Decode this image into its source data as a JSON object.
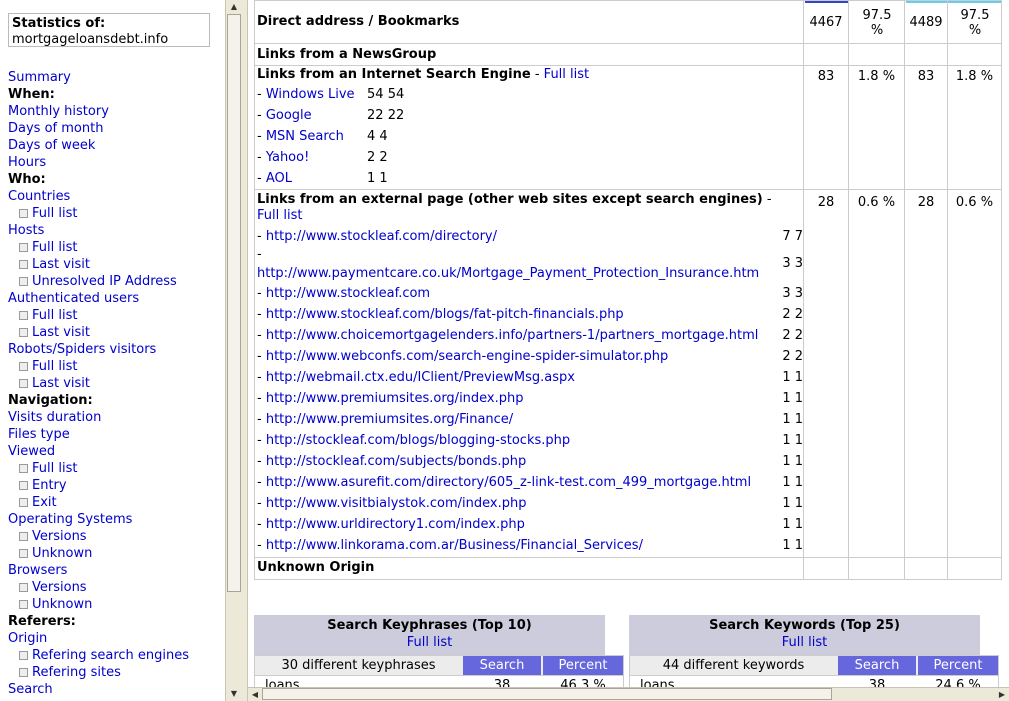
{
  "left": {
    "stats_title": "Statistics of:",
    "site": "mortgageloansdebt.info",
    "menu": [
      {
        "t": "Summary",
        "k": "link"
      },
      {
        "t": "When:",
        "k": "head"
      },
      {
        "t": "Monthly history",
        "k": "link"
      },
      {
        "t": "Days of month",
        "k": "link"
      },
      {
        "t": "Days of week",
        "k": "link"
      },
      {
        "t": "Hours",
        "k": "link"
      },
      {
        "t": "Who:",
        "k": "head"
      },
      {
        "t": "Countries",
        "k": "link"
      },
      {
        "t": "Full list",
        "k": "sub"
      },
      {
        "t": "Hosts",
        "k": "link"
      },
      {
        "t": "Full list",
        "k": "sub"
      },
      {
        "t": "Last visit",
        "k": "sub"
      },
      {
        "t": "Unresolved IP Address",
        "k": "sub"
      },
      {
        "t": "Authenticated users",
        "k": "link"
      },
      {
        "t": "Full list",
        "k": "sub"
      },
      {
        "t": "Last visit",
        "k": "sub"
      },
      {
        "t": "Robots/Spiders visitors",
        "k": "link"
      },
      {
        "t": "Full list",
        "k": "sub"
      },
      {
        "t": "Last visit",
        "k": "sub"
      },
      {
        "t": "Navigation:",
        "k": "head"
      },
      {
        "t": "Visits duration",
        "k": "link"
      },
      {
        "t": "Files type",
        "k": "link"
      },
      {
        "t": "Viewed",
        "k": "link"
      },
      {
        "t": "Full list",
        "k": "sub"
      },
      {
        "t": "Entry",
        "k": "sub"
      },
      {
        "t": "Exit",
        "k": "sub"
      },
      {
        "t": "Operating Systems",
        "k": "link"
      },
      {
        "t": "Versions",
        "k": "sub"
      },
      {
        "t": "Unknown",
        "k": "sub"
      },
      {
        "t": "Browsers",
        "k": "link"
      },
      {
        "t": "Versions",
        "k": "sub"
      },
      {
        "t": "Unknown",
        "k": "sub"
      },
      {
        "t": "Referers:",
        "k": "head"
      },
      {
        "t": "Origin",
        "k": "link"
      },
      {
        "t": "Refering search engines",
        "k": "sub"
      },
      {
        "t": "Refering sites",
        "k": "sub"
      },
      {
        "t": "Search",
        "k": "link"
      }
    ]
  },
  "origin": {
    "direct": {
      "label": "Direct address / Bookmarks",
      "pages": "4467",
      "pages_pct": "97.5 %",
      "hits": "4489",
      "hits_pct": "97.5 %"
    },
    "newsgroup": {
      "label": "Links from a NewsGroup"
    },
    "search_engine": {
      "label": "Links from an Internet Search Engine",
      "sep": " - ",
      "full_list": "Full list",
      "pages": "83",
      "pages_pct": "1.8 %",
      "hits": "83",
      "hits_pct": "1.8 %",
      "engines": [
        {
          "name": "Windows Live",
          "a": "54",
          "b": "54"
        },
        {
          "name": "Google",
          "a": "22",
          "b": "22"
        },
        {
          "name": "MSN Search",
          "a": "4",
          "b": "4"
        },
        {
          "name": "Yahoo!",
          "a": "2",
          "b": "2"
        },
        {
          "name": "AOL",
          "a": "1",
          "b": "1"
        }
      ]
    },
    "external": {
      "label": "Links from an external page (other web sites except search engines)",
      "sep": " -",
      "full_list": "Full list",
      "pages": "28",
      "pages_pct": "0.6 %",
      "hits": "28",
      "hits_pct": "0.6 %",
      "links": [
        {
          "url": "http://www.stockleaf.com/directory/",
          "c": "7 7"
        },
        {
          "url": "http://www.paymentcare.co.uk/Mortgage_Payment_Protection_Insurance.htm",
          "c": "3 3",
          "wrap": true
        },
        {
          "url": "http://www.stockleaf.com",
          "c": "3 3"
        },
        {
          "url": "http://www.stockleaf.com/blogs/fat-pitch-financials.php",
          "c": "2 2"
        },
        {
          "url": "http://www.choicemortgagelenders.info/partners-1/partners_mortgage.html",
          "c": "2 2"
        },
        {
          "url": "http://www.webconfs.com/search-engine-spider-simulator.php",
          "c": "2 2"
        },
        {
          "url": "http://webmail.ctx.edu/IClient/PreviewMsg.aspx",
          "c": "1 1"
        },
        {
          "url": "http://www.premiumsites.org/index.php",
          "c": "1 1"
        },
        {
          "url": "http://www.premiumsites.org/Finance/",
          "c": "1 1"
        },
        {
          "url": "http://stockleaf.com/blogs/blogging-stocks.php",
          "c": "1 1"
        },
        {
          "url": "http://stockleaf.com/subjects/bonds.php",
          "c": "1 1"
        },
        {
          "url": "http://www.asurefit.com/directory/605_z-link-test.com_499_mortgage.html",
          "c": "1 1"
        },
        {
          "url": "http://www.visitbialystok.com/index.php",
          "c": "1 1"
        },
        {
          "url": "http://www.urldirectory1.com/index.php",
          "c": "1 1"
        },
        {
          "url": "http://www.linkorama.com.ar/Business/Financial_Services/",
          "c": "1 1"
        }
      ]
    },
    "unknown": {
      "label": "Unknown Origin"
    }
  },
  "keyphrases": {
    "title": "Search Keyphrases (Top 10)",
    "full_list": "Full list",
    "count_label": "30 different keyphrases",
    "col_search": "Search",
    "col_percent": "Percent",
    "first_row": {
      "term": "loans",
      "search": "38",
      "percent": "46.3 %"
    }
  },
  "keywords": {
    "title": "Search Keywords (Top 25)",
    "full_list": "Full list",
    "count_label": "44 different keywords",
    "col_search": "Search",
    "col_percent": "Percent",
    "first_row": {
      "term": "loans",
      "search": "38",
      "percent": "24.6 %"
    }
  },
  "colors": {
    "link": "#0000cc",
    "header_bg": "#ccccdd",
    "col_header_bg": "#6666dd",
    "grid": "#cccccc"
  }
}
